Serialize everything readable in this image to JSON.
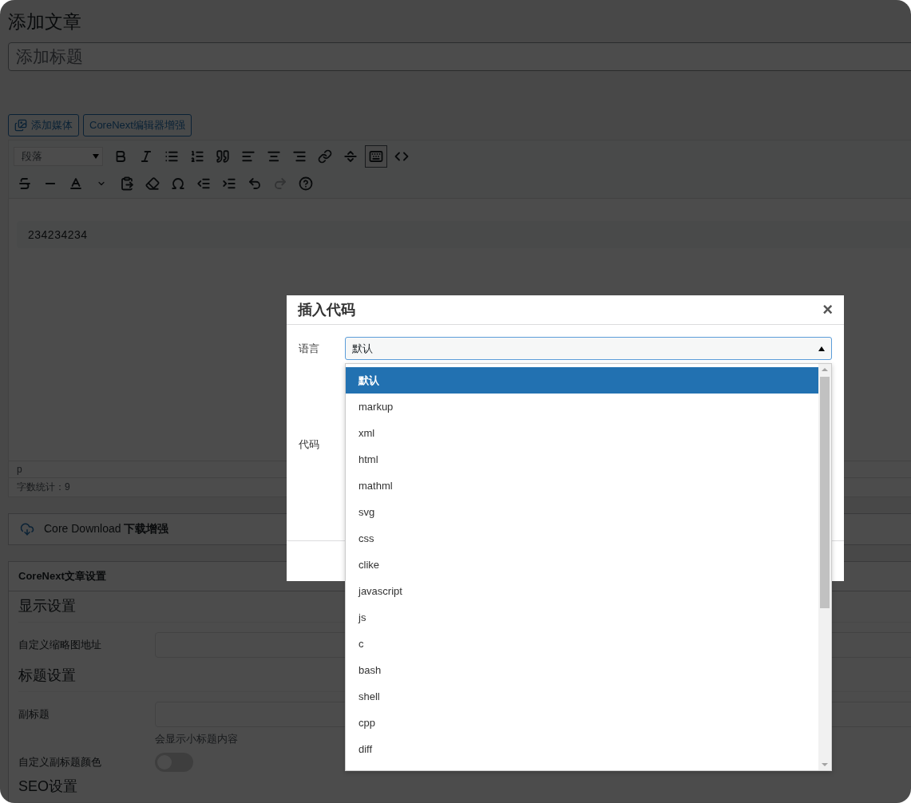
{
  "page": {
    "title": "添加文章"
  },
  "post_title": {
    "placeholder": "添加标题"
  },
  "media_buttons": [
    {
      "label": "添加媒体",
      "kind": "media"
    },
    {
      "label": "CoreNext编辑器增强",
      "kind": "plain"
    }
  ],
  "editor": {
    "format_select": "段落",
    "toolbar_row_1": [
      {
        "pressed": false,
        "disabled": false
      },
      {
        "pressed": false,
        "disabled": false
      },
      {
        "pressed": false,
        "disabled": false
      },
      {
        "pressed": false,
        "disabled": false
      },
      {
        "pressed": false,
        "disabled": false
      },
      {
        "pressed": false,
        "disabled": false
      },
      {
        "pressed": false,
        "disabled": false
      },
      {
        "pressed": false,
        "disabled": false
      },
      {
        "pressed": false,
        "disabled": false
      },
      {
        "pressed": false,
        "disabled": false
      },
      {
        "pressed": true,
        "disabled": false
      },
      {
        "pressed": false,
        "disabled": false
      }
    ],
    "toolbar_row_2": [
      {
        "pressed": false,
        "disabled": false
      },
      {
        "pressed": false,
        "disabled": false
      },
      {
        "pressed": false,
        "disabled": false
      },
      {
        "pressed": false,
        "disabled": false
      },
      {
        "pressed": false,
        "disabled": false
      },
      {
        "pressed": false,
        "disabled": false
      },
      {
        "pressed": false,
        "disabled": false
      },
      {
        "pressed": false,
        "disabled": false
      },
      {
        "pressed": false,
        "disabled": false
      },
      {
        "pressed": false,
        "disabled": false
      },
      {
        "pressed": false,
        "disabled": true
      },
      {
        "pressed": false,
        "disabled": false
      }
    ],
    "code_block": "234234234",
    "path": "p",
    "word_count": "字数统计：9"
  },
  "download_box": {
    "title": "Core Download",
    "title_bold": "下载增强"
  },
  "settings": {
    "title": "CoreNext文章设置",
    "sections": [
      {
        "heading": "显示设置",
        "fields": [
          {
            "kind": "input",
            "label": "自定义缩略图地址"
          }
        ]
      },
      {
        "heading": "标题设置",
        "fields": [
          {
            "kind": "input",
            "label": "副标题",
            "hint": "会显示小标题内容"
          },
          {
            "kind": "toggle",
            "label": "自定义副标题颜色",
            "on": false
          }
        ]
      },
      {
        "heading": "SEO设置"
      }
    ]
  },
  "modal": {
    "title": "插入代码",
    "close": "×",
    "language_label": "语言",
    "language_value": "默认",
    "open": true,
    "code_label": "代码",
    "options": [
      {
        "label": "默认",
        "selected": true
      },
      {
        "label": "markup",
        "selected": false
      },
      {
        "label": "xml",
        "selected": false
      },
      {
        "label": "html",
        "selected": false
      },
      {
        "label": "mathml",
        "selected": false
      },
      {
        "label": "svg",
        "selected": false
      },
      {
        "label": "css",
        "selected": false
      },
      {
        "label": "clike",
        "selected": false
      },
      {
        "label": "javascript",
        "selected": false
      },
      {
        "label": "js",
        "selected": false
      },
      {
        "label": "c",
        "selected": false
      },
      {
        "label": "bash",
        "selected": false
      },
      {
        "label": "shell",
        "selected": false
      },
      {
        "label": "cpp",
        "selected": false
      },
      {
        "label": "diff",
        "selected": false
      }
    ]
  }
}
